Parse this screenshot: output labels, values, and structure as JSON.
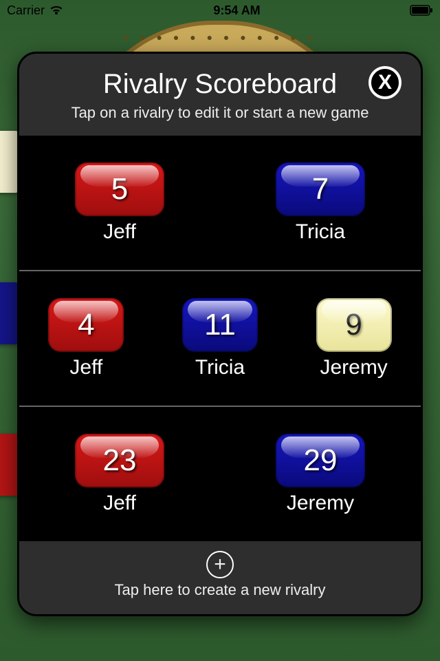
{
  "status": {
    "carrier": "Carrier",
    "time": "9:54 AM"
  },
  "modal": {
    "title": "Rivalry Scoreboard",
    "subtitle": "Tap on a rivalry to edit it or start a new game",
    "close_label": "X",
    "footer_text": "Tap here to create a new rivalry",
    "add_icon": "+"
  },
  "colors": {
    "red": "#c51515",
    "blue": "#10109a",
    "yellow": "#f5f0b0"
  },
  "rivalries": [
    {
      "players": [
        {
          "name": "Jeff",
          "score": "5",
          "color": "red"
        },
        {
          "name": "Tricia",
          "score": "7",
          "color": "blue"
        }
      ]
    },
    {
      "players": [
        {
          "name": "Jeff",
          "score": "4",
          "color": "red"
        },
        {
          "name": "Tricia",
          "score": "11",
          "color": "blue"
        },
        {
          "name": "Jeremy",
          "score": "9",
          "color": "yellow"
        }
      ]
    },
    {
      "players": [
        {
          "name": "Jeff",
          "score": "23",
          "color": "red"
        },
        {
          "name": "Jeremy",
          "score": "29",
          "color": "blue"
        }
      ]
    }
  ]
}
